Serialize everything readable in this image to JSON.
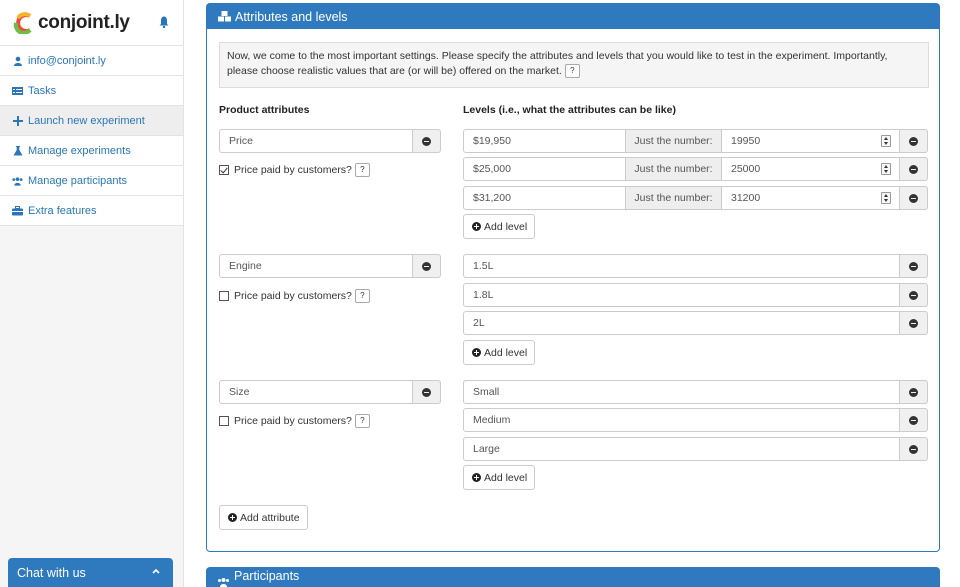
{
  "brand": {
    "name": "conjoint.ly"
  },
  "sidebar": {
    "items": [
      {
        "label": "info@conjoint.ly",
        "icon": "user-icon"
      },
      {
        "label": "Tasks",
        "icon": "tasks-icon"
      },
      {
        "label": "Launch new experiment",
        "icon": "plus-icon"
      },
      {
        "label": "Manage experiments",
        "icon": "flask-icon"
      },
      {
        "label": "Manage participants",
        "icon": "users-icon"
      },
      {
        "label": "Extra features",
        "icon": "briefcase-icon"
      }
    ]
  },
  "chat": {
    "label": "Chat with us"
  },
  "panel": {
    "title": "Attributes and levels",
    "info": "Now, we come to the most important settings. Please specify the attributes and levels that you would like to test in the experiment. Importantly, please choose realistic values that are (or will be) offered on the market.",
    "col_attributes": "Product attributes",
    "col_levels": "Levels (i.e., what the attributes can be like)",
    "price_label": "Price paid by customers?",
    "number_label": "Just the number:",
    "add_level": "Add level",
    "add_attribute": "Add attribute",
    "attributes": [
      {
        "name": "Price",
        "price_paid": true,
        "levels": [
          "$19,950",
          "$25,000",
          "$31,200"
        ],
        "numbers": [
          "19950",
          "25000",
          "31200"
        ]
      },
      {
        "name": "Engine",
        "price_paid": false,
        "levels": [
          "1.5L",
          "1.8L",
          "2L"
        ]
      },
      {
        "name": "Size",
        "price_paid": false,
        "levels": [
          "Small",
          "Medium",
          "Large"
        ]
      }
    ]
  },
  "panel2": {
    "title": "Participants"
  },
  "colors": {
    "primary": "#2f7abf",
    "link": "#2a76b8"
  }
}
